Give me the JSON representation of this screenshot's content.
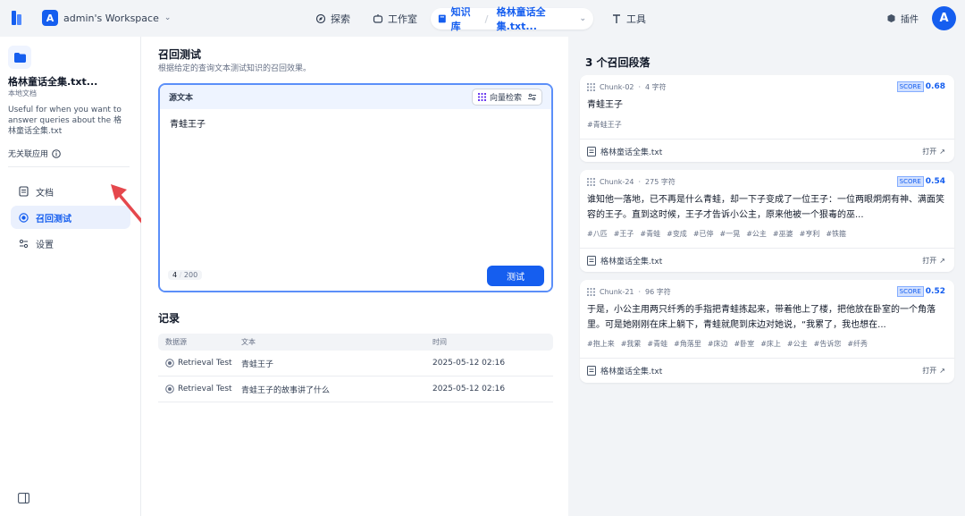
{
  "topbar": {
    "workspace_initial": "A",
    "workspace_name": "admin's Workspace",
    "nav": [
      {
        "label": "探索",
        "icon": "explore-icon"
      },
      {
        "label": "工作室",
        "icon": "studio-icon"
      },
      {
        "label": "知识库",
        "icon": "book-icon"
      },
      {
        "label": "工具",
        "icon": "tools-icon"
      }
    ],
    "kb_crumb": "格林童话全集.txt...",
    "plugin_label": "插件",
    "avatar_initial": "A"
  },
  "sidebar": {
    "kb_name": "格林童话全集.txt...",
    "kb_type": "本地文档",
    "kb_desc": "Useful for when you want to answer queries about the 格林童话全集.txt",
    "no_app": "无关联应用",
    "items": [
      {
        "label": "文档",
        "icon": "document-icon"
      },
      {
        "label": "召回测试",
        "icon": "target-icon"
      },
      {
        "label": "设置",
        "icon": "settings-icon"
      }
    ]
  },
  "main": {
    "title": "召回测试",
    "subtitle": "根据给定的查询文本测试知识的召回效果。",
    "query": {
      "label": "源文本",
      "mode": "向量检索",
      "text": "青蛙王子",
      "char_count": "4",
      "max_chars": "200",
      "button": "测试"
    },
    "records": {
      "title": "记录",
      "headers": [
        "数据源",
        "文本",
        "时间"
      ],
      "rows": [
        {
          "source": "Retrieval Test",
          "text": "青蛙王子",
          "time": "2025-05-12 02:16"
        },
        {
          "source": "Retrieval Test",
          "text": "青蛙王子的故事讲了什么",
          "time": "2025-05-12 02:16"
        }
      ]
    }
  },
  "results": {
    "title": "3 个召回段落",
    "cards": [
      {
        "chunk": "Chunk-02",
        "chars": "4 字符",
        "score_label": "SCORE",
        "score": "0.68",
        "text": "青蛙王子",
        "tags": [
          "青蛙王子"
        ],
        "file": "格林童话全集.txt",
        "open": "打开"
      },
      {
        "chunk": "Chunk-24",
        "chars": "275 字符",
        "score_label": "SCORE",
        "score": "0.54",
        "text": "谁知他一落地，已不再是什么青蛙，却一下子变成了一位王子：一位两眼炯炯有神、满面笑容的王子。直到这时候，王子才告诉小公主，原来他被一个狠毒的巫...",
        "tags": [
          "八匹",
          "王子",
          "青蛙",
          "变成",
          "已停",
          "一晃",
          "公主",
          "巫婆",
          "亨利",
          "铁箍"
        ],
        "file": "格林童话全集.txt",
        "open": "打开"
      },
      {
        "chunk": "Chunk-21",
        "chars": "96 字符",
        "score_label": "SCORE",
        "score": "0.52",
        "text": "于是，小公主用两只纤秀的手指把青蛙拣起来，带着他上了楼，把他放在卧室的一个角落里。可是她刚刚在床上躺下，青蛙就爬到床边对她说，“我累了，我也想在...",
        "tags": [
          "抱上来",
          "我累",
          "青蛙",
          "角落里",
          "床边",
          "卧室",
          "床上",
          "公主",
          "告诉您",
          "纤秀"
        ],
        "file": "格林童话全集.txt",
        "open": "打开"
      }
    ]
  }
}
